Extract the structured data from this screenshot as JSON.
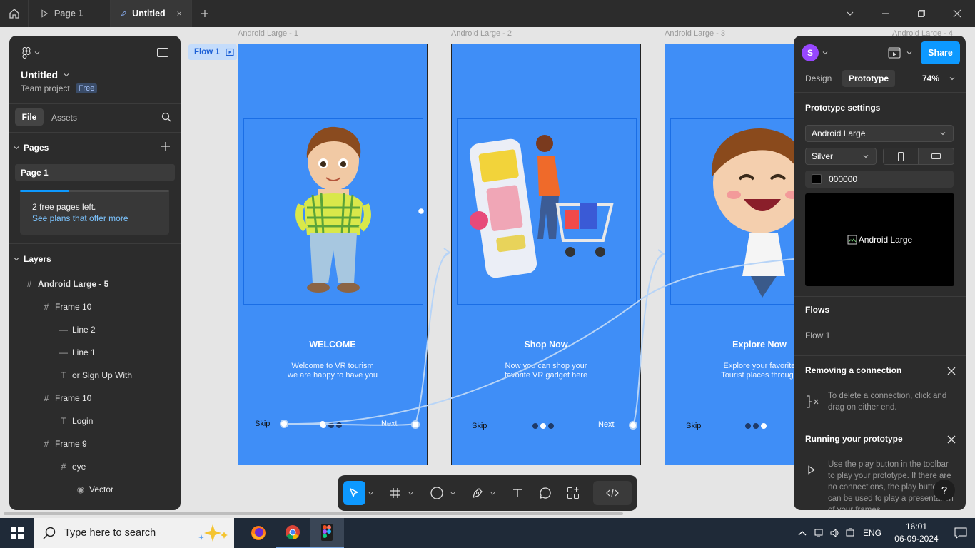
{
  "titlebar": {
    "tabs": [
      {
        "label": "Page 1"
      },
      {
        "label": "Untitled"
      }
    ]
  },
  "canvas": {
    "flow_tag": "Flow 1",
    "frames": [
      {
        "label": "Android Large - 1",
        "title": "WELCOME",
        "subtitle_1": "Welcome to VR tourism",
        "subtitle_2": "we are happy to have you",
        "skip": "Skip",
        "next": "Next",
        "active_dot": 0
      },
      {
        "label": "Android Large - 2",
        "title": "Shop Now",
        "subtitle_1": "Now you can shop your",
        "subtitle_2": "favorite VR gadget here",
        "skip": "Skip",
        "next": "Next",
        "active_dot": 1
      },
      {
        "label": "Android Large - 3",
        "title": "Explore Now",
        "subtitle_1": "Explore your favorite",
        "subtitle_2": "Tourist places through",
        "skip": "Skip",
        "next": "",
        "active_dot": 2
      }
    ],
    "partial_label": "Android Large - 4"
  },
  "left_panel": {
    "file_name": "Untitled",
    "team": "Team project",
    "plan_badge": "Free",
    "tab_file": "File",
    "tab_assets": "Assets",
    "pages_header": "Pages",
    "page_item": "Page 1",
    "free_pages_text": "2 free pages left.",
    "plans_link": "See plans that offer more",
    "free_pages_progress": 0.33,
    "layers_header": "Layers",
    "layers": [
      {
        "name": "Android Large - 5",
        "icon": "#",
        "depth": 0,
        "bold": true
      },
      {
        "name": "Frame 10",
        "icon": "#",
        "depth": 1
      },
      {
        "name": "Line 2",
        "icon": "—",
        "depth": 2
      },
      {
        "name": "Line 1",
        "icon": "—",
        "depth": 2
      },
      {
        "name": "or Sign Up With",
        "icon": "T",
        "depth": 2
      },
      {
        "name": "Frame 10",
        "icon": "#",
        "depth": 1
      },
      {
        "name": "Login",
        "icon": "T",
        "depth": 2
      },
      {
        "name": "Frame 9",
        "icon": "#",
        "depth": 1
      },
      {
        "name": "eye",
        "icon": "#",
        "depth": 2
      },
      {
        "name": "Vector",
        "icon": "◉",
        "depth": 3
      }
    ]
  },
  "right_panel": {
    "avatar_letter": "S",
    "share_label": "Share",
    "tab_design": "Design",
    "tab_prototype": "Prototype",
    "zoom": "74%",
    "settings_header": "Prototype settings",
    "device": "Android Large",
    "model": "Silver",
    "bg_color_hex": "000000",
    "preview_alt": "Android Large",
    "flows_header": "Flows",
    "flow_item": "Flow 1",
    "remove_header": "Removing a connection",
    "remove_hint": "To delete a connection, click and drag on either end.",
    "running_header": "Running your prototype",
    "running_hint": "Use the play button in the toolbar to play your prototype. If there are no connections, the play button can be used to play a presentation of your frames.",
    "help_label": "?"
  },
  "taskbar": {
    "search_placeholder": "Type here to search",
    "language": "ENG",
    "time": "16:01",
    "date": "06-09-2024"
  },
  "colors": {
    "frame_blue": "#3f8ef7",
    "accent": "#0d99ff",
    "avatar": "#9747ff"
  }
}
